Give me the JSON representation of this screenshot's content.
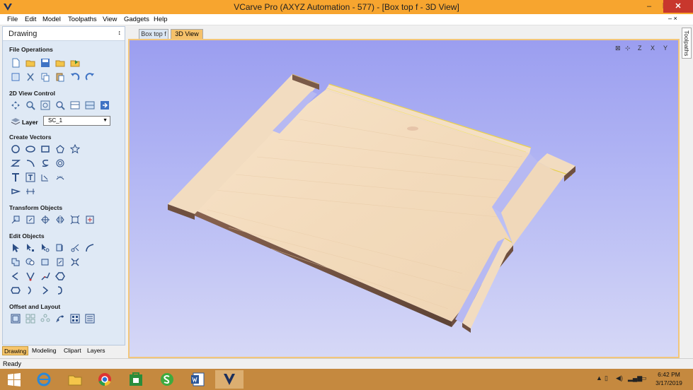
{
  "window": {
    "title": "VCarve Pro (AXYZ Automation - 577) - [Box top f - 3D View]",
    "minimize": "–",
    "maximize": "❒",
    "close": "✕"
  },
  "menu": {
    "items": [
      "File",
      "Edit",
      "Model",
      "Toolpaths",
      "View",
      "Gadgets",
      "Help"
    ],
    "right_controls": "– ×"
  },
  "left_panel": {
    "title": "Drawing",
    "pin": "↕",
    "sections": {
      "file_operations": "File Operations",
      "view_control": "2D View Control",
      "create_vectors": "Create Vectors",
      "transform_objects": "Transform Objects",
      "edit_objects": "Edit Objects",
      "offset_layout": "Offset and Layout"
    },
    "layer_label": "Layer",
    "layer_value": "SC_1",
    "bottom_tabs": [
      "Drawing",
      "Modeling",
      "Clipart",
      "Layers"
    ]
  },
  "view_tabs": {
    "tabs": [
      "Box top f",
      "3D View"
    ],
    "active": "3D View",
    "close": "×"
  },
  "right_tab": "Toolpaths",
  "status": "Ready",
  "taskbar": {
    "time": "6:42 PM",
    "date": "3/17/2019"
  },
  "colors": {
    "title_bar": "#f7a52f",
    "panel_bg": "#dfe9f5",
    "viewport_top": "#9b9ef0",
    "wood_top": "#f4dcc0",
    "wood_side": "#7a5a48",
    "taskbar": "#c5893f"
  }
}
